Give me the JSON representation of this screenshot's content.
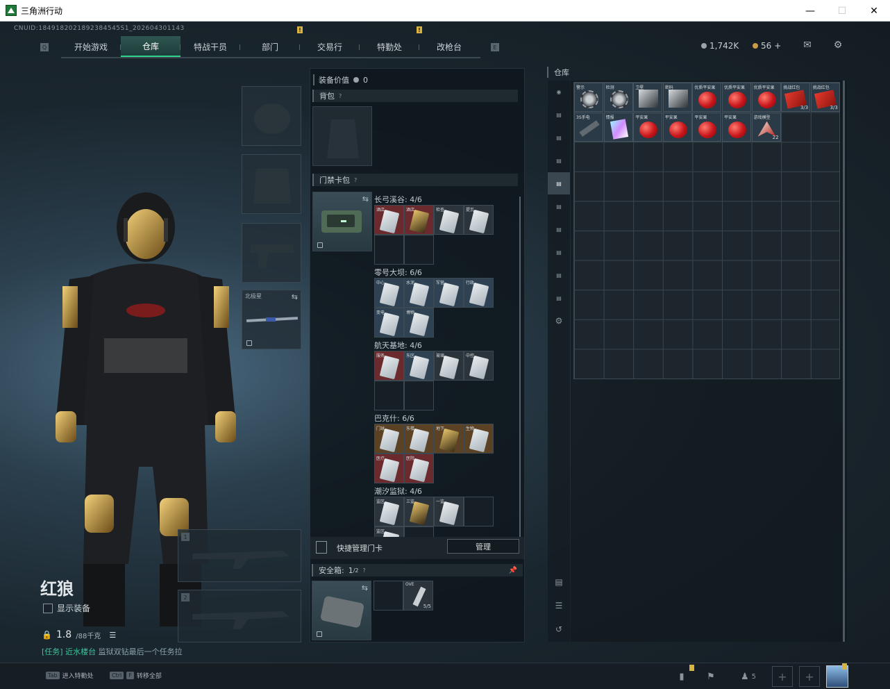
{
  "window": {
    "title": "三角洲行动"
  },
  "header": {
    "uid": "CNUID:1849182021892384545S1_202604301143",
    "tabs": [
      {
        "label": "开始游戏",
        "active": false,
        "badge": false
      },
      {
        "label": "仓库",
        "active": true,
        "badge": false
      },
      {
        "label": "特战干员",
        "active": false,
        "badge": false
      },
      {
        "label": "部门",
        "active": false,
        "badge": true
      },
      {
        "label": "交易行",
        "active": false,
        "badge": false
      },
      {
        "label": "特勤处",
        "active": false,
        "badge": true
      },
      {
        "label": "改枪台",
        "active": false,
        "badge": false
      }
    ],
    "key_left": "Q",
    "key_right": "E",
    "currency_main": "1,742K",
    "currency_premium": "56",
    "currency_add": "+",
    "accent_color": "#2fd48c"
  },
  "character": {
    "name": "红狼",
    "show_equipment_label": "显示装备",
    "weight_current": "1.8",
    "weight_max": "/88千克",
    "task_prefix": "[任务]",
    "task_highlight": "近水楼台",
    "task_text": "监狱双钻最后一个任务拉"
  },
  "equipment_slots": {
    "melee_label": "北极星"
  },
  "weapon_slots": [
    {
      "num": "1"
    },
    {
      "num": "2"
    }
  ],
  "middle": {
    "equip_value_label": "装备价值",
    "equip_value": "0",
    "backpack_label": "背包",
    "keycard_label": "门禁卡包",
    "maps": [
      {
        "title": "长弓溪谷: 4/6",
        "cards": [
          {
            "tag": "酒店",
            "style": "red"
          },
          {
            "tag": "酒店",
            "style": "red",
            "gold": true
          },
          {
            "tag": "检查",
            "style": "has"
          },
          {
            "tag": "提瓦",
            "style": "has"
          },
          {
            "tag": "",
            "style": "empty"
          },
          {
            "tag": "",
            "style": "empty"
          }
        ]
      },
      {
        "title": "零号大坝: 6/6",
        "cards": [
          {
            "tag": "中心",
            "style": "blue"
          },
          {
            "tag": "水泥",
            "style": "blue"
          },
          {
            "tag": "军营",
            "style": "blue"
          },
          {
            "tag": "行政",
            "style": "blue"
          },
          {
            "tag": "变电",
            "style": "blue"
          },
          {
            "tag": "博物",
            "style": "blue"
          }
        ]
      },
      {
        "title": "航天基地: 4/6",
        "cards": [
          {
            "tag": "服务",
            "style": "red"
          },
          {
            "tag": "东区",
            "style": "blue"
          },
          {
            "tag": "玻璃",
            "style": "has"
          },
          {
            "tag": "中控",
            "style": "has"
          },
          {
            "tag": "",
            "style": "empty"
          },
          {
            "tag": "",
            "style": "empty"
          }
        ]
      },
      {
        "title": "巴克什: 6/6",
        "cards": [
          {
            "tag": "门球",
            "style": "gold"
          },
          {
            "tag": "东楼",
            "style": "gold"
          },
          {
            "tag": "地下",
            "style": "gold",
            "gold": true
          },
          {
            "tag": "生物",
            "style": "gold"
          },
          {
            "tag": "医疗",
            "style": "red"
          },
          {
            "tag": "医院",
            "style": "red"
          }
        ]
      },
      {
        "title": "潮汐监狱: 4/6",
        "cards": [
          {
            "tag": "监区",
            "style": "has"
          },
          {
            "tag": "三监",
            "style": "has",
            "gold": true
          },
          {
            "tag": "一监",
            "style": "has"
          },
          {
            "tag": "",
            "style": "empty"
          },
          {
            "tag": "监区",
            "style": "has"
          },
          {
            "tag": "",
            "style": "empty"
          }
        ]
      }
    ],
    "quick_manage_label": "快捷管理门卡",
    "manage_button": "管理",
    "safebox_label": "安全箱:",
    "safebox_value": "1",
    "safebox_max": "/2",
    "safebox_item": {
      "tag": "OVE",
      "count": "5/5"
    }
  },
  "warehouse": {
    "title": "仓库",
    "items": [
      {
        "tag": "警示",
        "kind": "gear",
        "count": ""
      },
      {
        "tag": "检测",
        "kind": "gear",
        "count": ""
      },
      {
        "tag": "卫星",
        "kind": "darkbox",
        "count": ""
      },
      {
        "tag": "密码",
        "kind": "darkbox",
        "count": ""
      },
      {
        "tag": "优质平安果",
        "kind": "apple",
        "count": ""
      },
      {
        "tag": "优质平安果",
        "kind": "apple",
        "count": ""
      },
      {
        "tag": "优质平安果",
        "kind": "apple",
        "count": ""
      },
      {
        "tag": "挑战红包",
        "kind": "envelope",
        "count": "3/3"
      },
      {
        "tag": "挑战红包",
        "kind": "envelope",
        "count": "3/3"
      },
      {
        "tag": "3S手电",
        "kind": "rifle",
        "count": ""
      },
      {
        "tag": "情报",
        "kind": "holo",
        "count": ""
      },
      {
        "tag": "平安果",
        "kind": "apple",
        "count": ""
      },
      {
        "tag": "平安果",
        "kind": "apple",
        "count": ""
      },
      {
        "tag": "平安果",
        "kind": "apple",
        "count": ""
      },
      {
        "tag": "平安果",
        "kind": "apple",
        "count": ""
      },
      {
        "tag": "游戏模型",
        "kind": "plane",
        "count": "22"
      }
    ]
  },
  "bottom": {
    "hint1_key": "Tab",
    "hint1_label": "进入特勤处",
    "hint2_key1": "Ctrl",
    "hint2_key2": "F",
    "hint2_label": "转移全部",
    "friends_count": "5"
  }
}
